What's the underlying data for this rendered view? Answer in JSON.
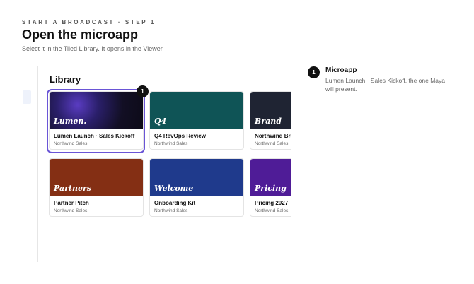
{
  "header": {
    "eyebrow": "START A BROADCAST · STEP 1",
    "title": "Open the microapp",
    "subtitle": "Select it in the Tiled Library. It opens in the Viewer."
  },
  "library": {
    "title": "Library",
    "cards": [
      {
        "thumb_word": "Lumen.",
        "title": "Lumen Launch · Sales Kickoff",
        "subtitle": "Northwind Sales",
        "color": "#1a1530",
        "selected": true
      },
      {
        "thumb_word": "Q4",
        "title": "Q4 RevOps Review",
        "subtitle": "Northwind Sales",
        "color": "#0f5456"
      },
      {
        "thumb_word": "Brand",
        "title": "Northwind Brand",
        "subtitle": "Northwind Sales",
        "color": "#1f2433"
      },
      {
        "thumb_word": "Partners",
        "title": "Partner Pitch",
        "subtitle": "Northwind Sales",
        "color": "#842f14"
      },
      {
        "thumb_word": "Welcome",
        "title": "Onboarding Kit",
        "subtitle": "Northwind Sales",
        "color": "#1f3a8c"
      },
      {
        "thumb_word": "Pricing",
        "title": "Pricing 2027",
        "subtitle": "Northwind Sales",
        "color": "#4f1c97"
      }
    ]
  },
  "step": {
    "number": "1"
  },
  "callout": {
    "number": "1",
    "title": "Microapp",
    "body": "Lumen Launch · Sales Kickoff, the one Maya will present."
  },
  "colors": {
    "accent": "#6a55d6",
    "marker": "#111111"
  }
}
